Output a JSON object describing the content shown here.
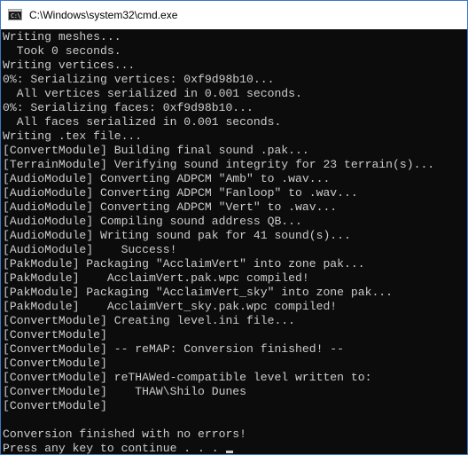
{
  "window": {
    "title": "C:\\Windows\\system32\\cmd.exe",
    "icon": "cmd-icon",
    "icon_prompt": "C:\\"
  },
  "console": {
    "background": "#0c0c0c",
    "foreground": "#cccccc",
    "lines": [
      "Writing meshes...",
      "  Took 0 seconds.",
      "Writing vertices...",
      "0%: Serializing vertices: 0xf9d98b10...",
      "  All vertices serialized in 0.001 seconds.",
      "0%: Serializing faces: 0xf9d98b10...",
      "  All faces serialized in 0.001 seconds.",
      "Writing .tex file...",
      "[ConvertModule] Building final sound .pak...",
      "[TerrainModule] Verifying sound integrity for 23 terrain(s)...",
      "[AudioModule] Converting ADPCM \"Amb\" to .wav...",
      "[AudioModule] Converting ADPCM \"Fanloop\" to .wav...",
      "[AudioModule] Converting ADPCM \"Vert\" to .wav...",
      "[AudioModule] Compiling sound address QB...",
      "[AudioModule] Writing sound pak for 41 sound(s)...",
      "[AudioModule]    Success!",
      "[PakModule] Packaging \"AcclaimVert\" into zone pak...",
      "[PakModule]    AcclaimVert.pak.wpc compiled!",
      "[PakModule] Packaging \"AcclaimVert_sky\" into zone pak...",
      "[PakModule]    AcclaimVert_sky.pak.wpc compiled!",
      "[ConvertModule] Creating level.ini file...",
      "[ConvertModule]",
      "[ConvertModule] -- reMAP: Conversion finished! --",
      "[ConvertModule]",
      "[ConvertModule] reTHAWed-compatible level written to:",
      "[ConvertModule]    THAW\\Shilo Dunes",
      "[ConvertModule]",
      "",
      "Conversion finished with no errors!",
      "Press any key to continue . . . "
    ]
  }
}
